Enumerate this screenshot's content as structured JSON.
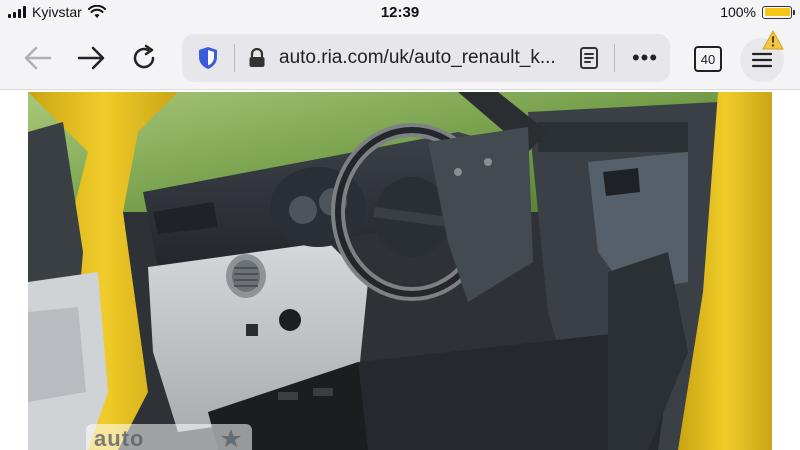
{
  "status": {
    "carrier": "Kyivstar",
    "time": "12:39",
    "battery_pct": "100%",
    "battery_level": 1.0,
    "signal_bars": 4,
    "icons": [
      "cellular-signal-icon",
      "wifi-icon",
      "battery-icon"
    ]
  },
  "toolbar": {
    "back_icon": "arrow-left-icon",
    "forward_icon": "arrow-right-icon",
    "reload_icon": "reload-icon",
    "shield_icon": "shield-icon",
    "lock_icon": "lock-icon",
    "url": "auto.ria.com/uk/auto_renault_k...",
    "reader_icon": "reader-view-icon",
    "more_label": "•••",
    "tab_count": "40",
    "menu_icon": "hamburger-menu-icon",
    "warning_icon": "warning-icon"
  },
  "content": {
    "photo_subject": "car-interior-photo",
    "watermark_text": "auto"
  },
  "colors": {
    "chrome_bg": "#f4f4f6",
    "url_bar_bg": "#e6e6eb",
    "shield": "#3b5bdb",
    "battery": "#f5c518",
    "warning": "#f2c744",
    "car_yellow": "#e8c21f"
  }
}
